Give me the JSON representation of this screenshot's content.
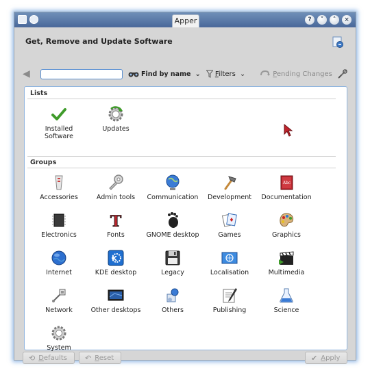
{
  "window": {
    "title": "Apper"
  },
  "header": {
    "title": "Get, Remove and Update Software"
  },
  "toolbar": {
    "search_value": "",
    "find_by_name": "Find by name",
    "filters_u": "F",
    "filters_rest": "ilters",
    "pending_u": "P",
    "pending_rest": "ending Changes"
  },
  "lists": {
    "title": "Lists",
    "items": [
      {
        "label": "Installed Software",
        "icon": "checkmark-icon"
      },
      {
        "label": "Updates",
        "icon": "updates-gear-icon"
      }
    ]
  },
  "groups": {
    "title": "Groups",
    "items": [
      {
        "label": "Accessories",
        "icon": "accessories-icon"
      },
      {
        "label": "Admin tools",
        "icon": "admin-tools-icon"
      },
      {
        "label": "Communication",
        "icon": "communication-globe-icon"
      },
      {
        "label": "Development",
        "icon": "hammer-icon"
      },
      {
        "label": "Documentation",
        "icon": "book-icon"
      },
      {
        "label": "Electronics",
        "icon": "chip-icon"
      },
      {
        "label": "Fonts",
        "icon": "font-icon"
      },
      {
        "label": "GNOME desktop",
        "icon": "gnome-foot-icon"
      },
      {
        "label": "Games",
        "icon": "cards-icon"
      },
      {
        "label": "Graphics",
        "icon": "palette-icon"
      },
      {
        "label": "Internet",
        "icon": "internet-globe-icon"
      },
      {
        "label": "KDE desktop",
        "icon": "kde-icon"
      },
      {
        "label": "Legacy",
        "icon": "floppy-icon"
      },
      {
        "label": "Localisation",
        "icon": "un-flag-icon"
      },
      {
        "label": "Multimedia",
        "icon": "clapper-icon"
      },
      {
        "label": "Network",
        "icon": "network-icon"
      },
      {
        "label": "Other desktops",
        "icon": "monitor-icon"
      },
      {
        "label": "Others",
        "icon": "others-icon"
      },
      {
        "label": "Publishing",
        "icon": "publishing-icon"
      },
      {
        "label": "Science",
        "icon": "flask-icon"
      },
      {
        "label": "System",
        "icon": "system-gear-icon"
      }
    ]
  },
  "footer": {
    "defaults_u": "D",
    "defaults_rest": "efaults",
    "reset_u": "R",
    "reset_rest": "eset",
    "apply_u": "A",
    "apply_rest": "pply"
  },
  "colors": {
    "accent": "#5a8fd1",
    "titlebar": "#5b7aa8",
    "background": "#d6d6d6"
  }
}
